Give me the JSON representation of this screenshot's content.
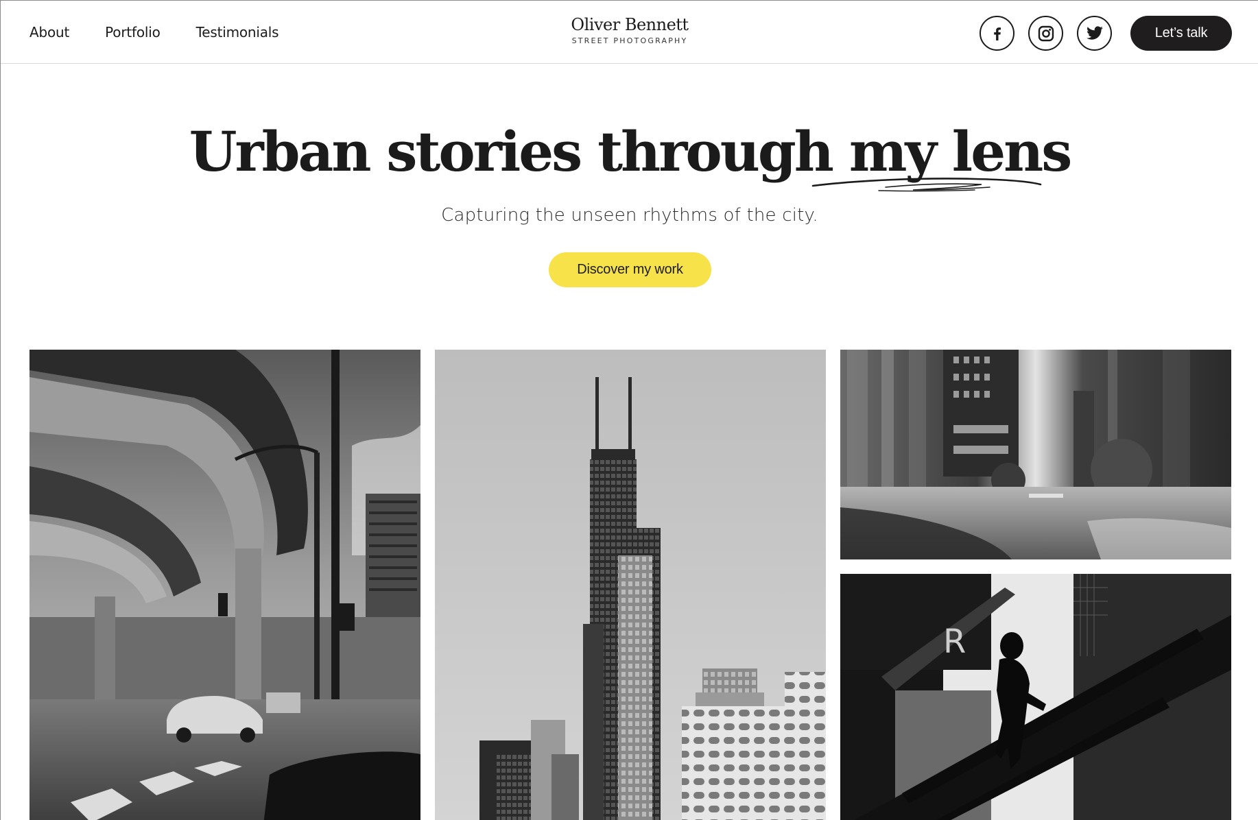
{
  "header": {
    "nav": [
      {
        "label": "About"
      },
      {
        "label": "Portfolio"
      },
      {
        "label": "Testimonials"
      }
    ],
    "brand": {
      "name": "Oliver Bennett",
      "tagline": "STREET PHOTOGRAPHY"
    },
    "social": [
      {
        "icon": "facebook-icon",
        "letter": "f"
      },
      {
        "icon": "instagram-icon"
      },
      {
        "icon": "twitter-icon"
      }
    ],
    "cta_label": "Let’s talk"
  },
  "hero": {
    "title_part1": "Urban stories through ",
    "title_accent": "my lens",
    "subtitle": "Capturing the unseen rhythms of the city.",
    "cta_label": "Discover my work",
    "cta_color": "#f7e24a"
  },
  "gallery": [
    {
      "subject": "elevated highway and street intersection"
    },
    {
      "subject": "skyscraper tower skyline"
    },
    {
      "subject": "blurred city street with motion"
    },
    {
      "subject": "silhouette descending stairs"
    }
  ],
  "colors": {
    "ink": "#1c1b1c",
    "accent": "#f7e24a",
    "background": "#ffffff"
  }
}
